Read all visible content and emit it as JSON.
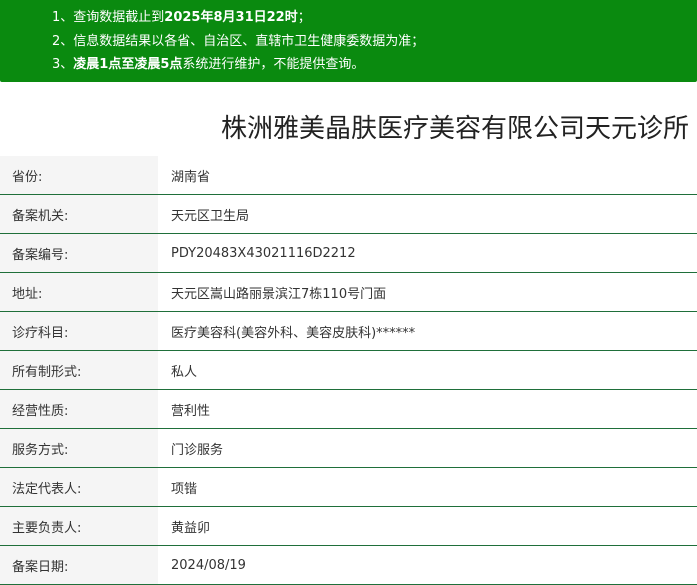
{
  "notices": [
    {
      "num": "1、",
      "parts": [
        {
          "text": "查询数据截止到",
          "bold": false
        },
        {
          "text": "2025年8月31日22时",
          "bold": true
        },
        {
          "text": "；",
          "bold": false
        }
      ]
    },
    {
      "num": "2、",
      "parts": [
        {
          "text": "信息数据结果以各省、自治区、直辖市卫生健康委数据为准；",
          "bold": false
        }
      ]
    },
    {
      "num": "3、",
      "parts": [
        {
          "text": "凌晨1点至凌晨5点",
          "bold": true
        },
        {
          "text": "系统进行维护，不能提供查询。",
          "bold": false
        }
      ]
    }
  ],
  "title": "株洲雅美晶肤医疗美容有限公司天元诊所",
  "rows": [
    {
      "label": "省份:",
      "value": "湖南省"
    },
    {
      "label": "备案机关:",
      "value": "天元区卫生局"
    },
    {
      "label": "备案编号:",
      "value": "PDY20483X43021116D2212"
    },
    {
      "label": "地址:",
      "value": "天元区嵩山路丽景滨江7栋110号门面"
    },
    {
      "label": "诊疗科目:",
      "value": "医疗美容科(美容外科、美容皮肤科)******"
    },
    {
      "label": "所有制形式:",
      "value": "私人"
    },
    {
      "label": "经营性质:",
      "value": "营利性"
    },
    {
      "label": "服务方式:",
      "value": "门诊服务"
    },
    {
      "label": "法定代表人:",
      "value": "项锴"
    },
    {
      "label": "主要负责人:",
      "value": "黄益卯"
    },
    {
      "label": "备案日期:",
      "value": "2024/08/19"
    }
  ],
  "colors": {
    "notice_bg": "#0a8a0f",
    "row_border": "#1f6f3a",
    "label_bg": "#f5f5f5"
  }
}
